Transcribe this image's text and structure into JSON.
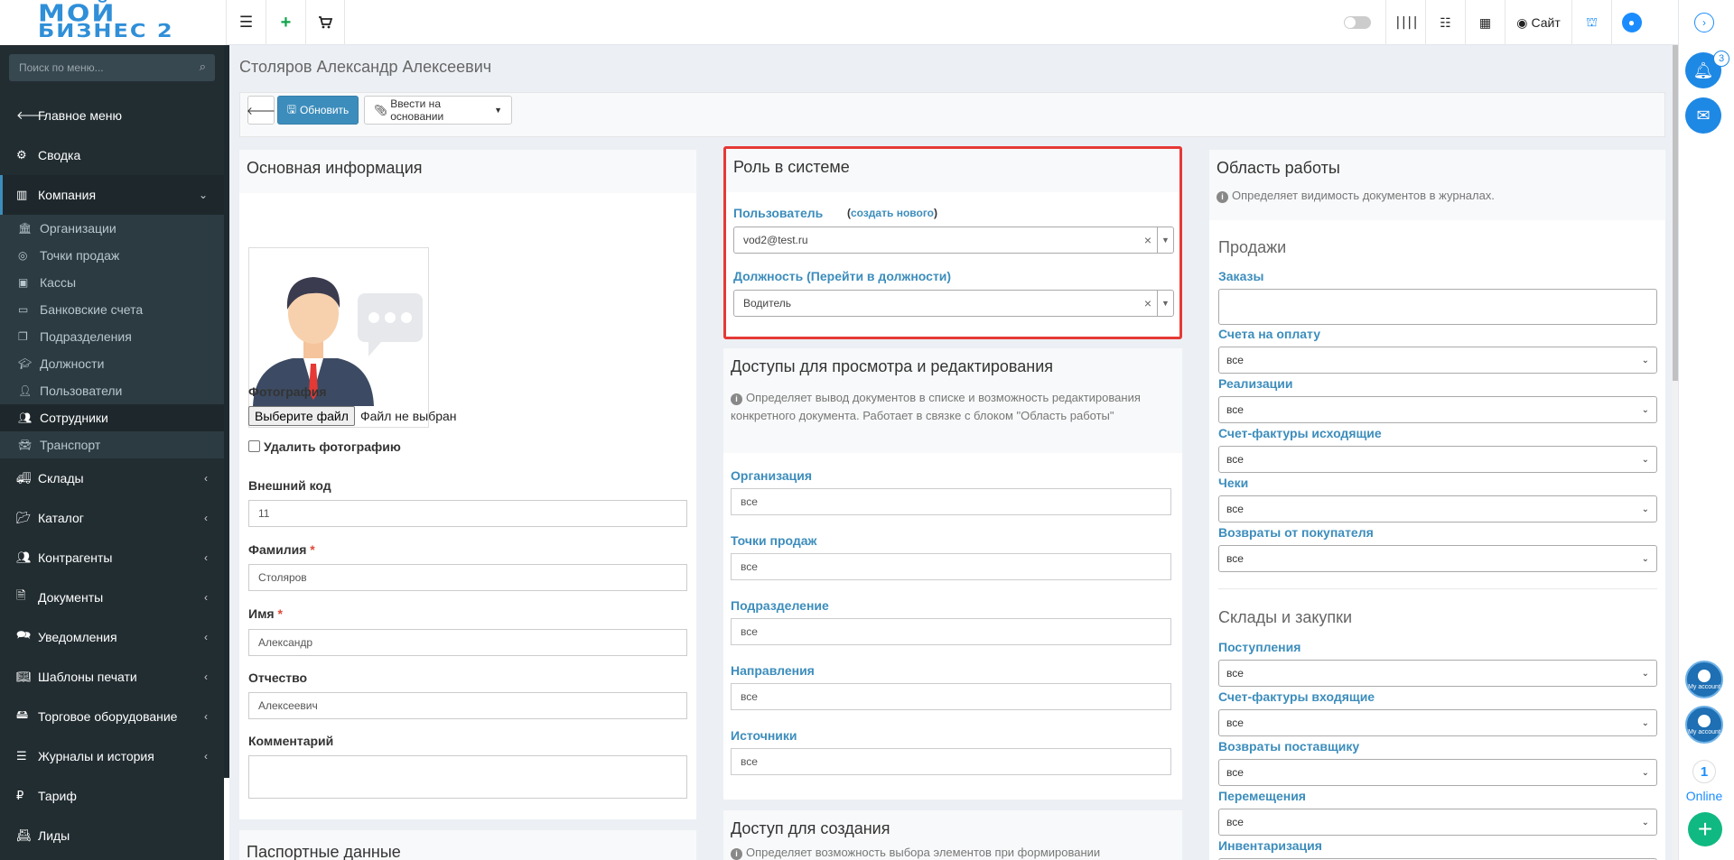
{
  "logo": {
    "line1": "МОЙ",
    "line2": "БИЗНЕС 2"
  },
  "topbar": {
    "site_label": "Сайт"
  },
  "sidebar": {
    "search_placeholder": "Поиск по меню...",
    "items": [
      {
        "label": "Главное меню",
        "icon": "arrow-left-icon"
      },
      {
        "label": "Сводка",
        "icon": "gear-icon"
      },
      {
        "label": "Компания",
        "icon": "chart-icon"
      }
    ],
    "company_sub": [
      {
        "label": "Организации"
      },
      {
        "label": "Точки продаж"
      },
      {
        "label": "Кассы"
      },
      {
        "label": "Банковские счета"
      },
      {
        "label": "Подразделения"
      },
      {
        "label": "Должности"
      },
      {
        "label": "Пользователи"
      },
      {
        "label": "Сотрудники"
      },
      {
        "label": "Транспорт"
      }
    ],
    "items2": [
      {
        "label": "Склады"
      },
      {
        "label": "Каталог"
      },
      {
        "label": "Контрагенты"
      },
      {
        "label": "Документы"
      },
      {
        "label": "Уведомления"
      },
      {
        "label": "Шаблоны печати"
      },
      {
        "label": "Торговое оборудование"
      },
      {
        "label": "Журналы и история"
      },
      {
        "label": "Тариф"
      },
      {
        "label": "Лиды"
      }
    ]
  },
  "page": {
    "title": "Столяров Александр Алексеевич",
    "buttons": {
      "refresh": "Обновить",
      "based_on": "Ввести на основании"
    }
  },
  "main_info": {
    "title": "Основная информация",
    "photo_label": "Фотография",
    "file_button": "Выберите файл",
    "file_status": "Файл не выбран",
    "delete_photo": "Удалить фотографию",
    "ext_code_label": "Внешний код",
    "ext_code_value": "11",
    "lastname_label": "Фамилия",
    "lastname_value": "Столяров",
    "firstname_label": "Имя",
    "firstname_value": "Александр",
    "middlename_label": "Отчество",
    "middlename_value": "Алексеевич",
    "comment_label": "Комментарий",
    "passport_title": "Паспортные данные"
  },
  "role": {
    "title": "Роль в системе",
    "user_label": "Пользователь",
    "create_new_link": "создать нового",
    "user_value": "vod2@test.ru",
    "position_label": "Должность (Перейти в должности)",
    "position_value": "Водитель"
  },
  "access": {
    "title": "Доступы для просмотра и редактирования",
    "hint": "Определяет вывод документов в списке и возможность редактирования конкретного документа. Работает в связке с блоком \"Область работы\"",
    "fields": [
      {
        "label": "Организация",
        "value": "все"
      },
      {
        "label": "Точки продаж",
        "value": "все"
      },
      {
        "label": "Подразделение",
        "value": "все"
      },
      {
        "label": "Направления",
        "value": "все"
      },
      {
        "label": "Источники",
        "value": "все"
      }
    ],
    "create_title": "Доступ для создания",
    "create_hint": "Определяет возможность выбора элементов при формировании"
  },
  "work_area": {
    "title": "Область работы",
    "hint": "Определяет видимость документов в журналах.",
    "sales_title": "Продажи",
    "orders_label": "Заказы",
    "sales_fields": [
      {
        "label": "Счета на оплату",
        "value": "все"
      },
      {
        "label": "Реализации",
        "value": "все"
      },
      {
        "label": "Счет-фактуры исходящие",
        "value": "все"
      },
      {
        "label": "Чеки",
        "value": "все"
      },
      {
        "label": "Возвраты от покупателя",
        "value": "все"
      }
    ],
    "warehouse_title": "Склады и закупки",
    "warehouse_fields": [
      {
        "label": "Поступления",
        "value": "все"
      },
      {
        "label": "Счет-фактуры входящие",
        "value": "все"
      },
      {
        "label": "Возвраты поставщику",
        "value": "все"
      },
      {
        "label": "Перемещения",
        "value": "все"
      },
      {
        "label": "Инвентаризация",
        "value": ""
      }
    ]
  },
  "rail": {
    "badge": "3",
    "account_label": "My account",
    "online_count": "1",
    "online_label": "Online"
  },
  "colors": {
    "accent": "#3c8dbc",
    "highlight": "#e53935",
    "sidebar": "#222d32"
  }
}
